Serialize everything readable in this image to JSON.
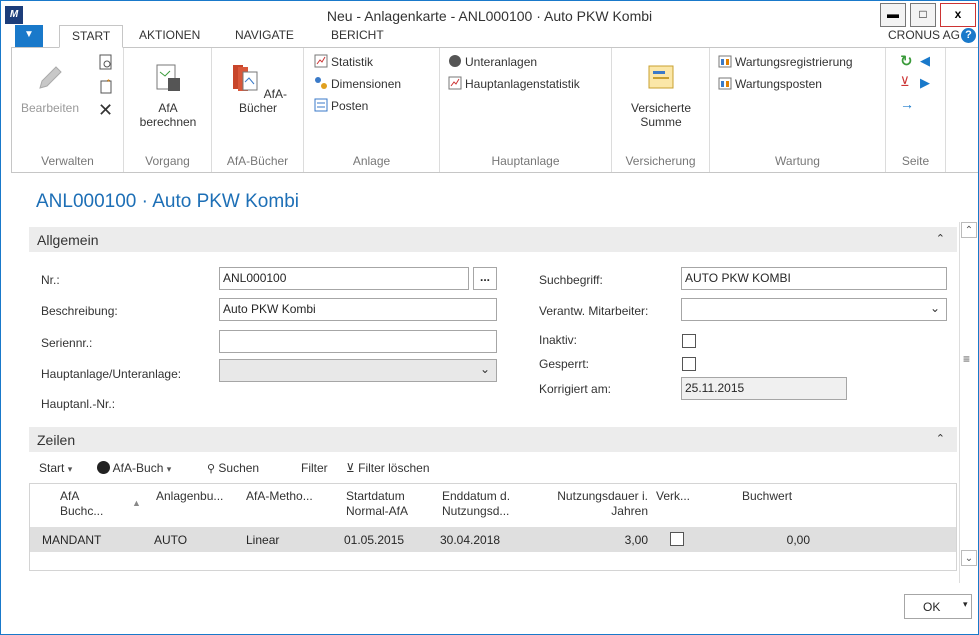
{
  "window": {
    "title": "Neu - Anlagenkarte - ANL000100 · Auto PKW Kombi",
    "app_logo": "M",
    "min_label": "▬",
    "max_label": "□",
    "close_label": "x"
  },
  "ribbon_tabs": [
    "START",
    "AKTIONEN",
    "NAVIGATE",
    "BERICHT"
  ],
  "company": "CRONUS AG",
  "ribbon": {
    "groups": [
      {
        "label": "Verwalten"
      },
      {
        "label": "Vorgang"
      },
      {
        "label": "AfA-Bücher"
      },
      {
        "label": "Anlage"
      },
      {
        "label": "Hauptanlage"
      },
      {
        "label": "Versicherung"
      },
      {
        "label": "Wartung"
      },
      {
        "label": "Seite"
      }
    ],
    "bearbeiten": "Bearbeiten",
    "afa_berechnen_1": "AfA",
    "afa_berechnen_2": "berechnen",
    "afa_buecher": "AfA-Bücher",
    "statistik": "Statistik",
    "dimensionen": "Dimensionen",
    "posten": "Posten",
    "unteranlagen": "Unteranlagen",
    "hauptanlagenstatistik": "Hauptanlagenstatistik",
    "versicherte_1": "Versicherte",
    "versicherte_2": "Summe",
    "wartungsregistrierung": "Wartungsregistrierung",
    "wartungsposten": "Wartungsposten"
  },
  "page_title": "ANL000100 · Auto PKW Kombi",
  "allgemein": {
    "title": "Allgemein",
    "nr_label": "Nr.:",
    "nr_value": "ANL000100",
    "ellipsis": "...",
    "beschreibung_label": "Beschreibung:",
    "beschreibung_value": "Auto PKW Kombi",
    "seriennr_label": "Seriennr.:",
    "seriennr_value": "",
    "hauptanlage_label": "Hauptanlage/Unteranlage:",
    "hauptanlage_value": "",
    "hauptanl_nr_label": "Hauptanl.-Nr.:",
    "suchbegriff_label": "Suchbegriff:",
    "suchbegriff_value": "AUTO PKW KOMBI",
    "verantw_label": "Verantw. Mitarbeiter:",
    "verantw_value": "",
    "inaktiv_label": "Inaktiv:",
    "gesperrt_label": "Gesperrt:",
    "korrigiert_label": "Korrigiert am:",
    "korrigiert_value": "25.11.2015"
  },
  "zeilen": {
    "title": "Zeilen",
    "toolbar": {
      "start": "Start",
      "afa_buch": "AfA-Buch",
      "suchen": "Suchen",
      "filter": "Filter",
      "filter_loeschen": "Filter löschen"
    },
    "headers": [
      [
        "AfA",
        "Buchc..."
      ],
      [
        "Anlagenbu..."
      ],
      [
        "AfA-Metho..."
      ],
      [
        "Startdatum",
        "Normal-AfA"
      ],
      [
        "Enddatum d.",
        "Nutzungsd..."
      ],
      [
        "Nutzungsdauer i.",
        "Jahren"
      ],
      [
        "Verk..."
      ],
      [
        "Buchwert"
      ]
    ],
    "rows": [
      {
        "afa_buch": "MANDANT",
        "anlagenbuch": "AUTO",
        "methode": "Linear",
        "startdatum": "01.05.2015",
        "enddatum": "30.04.2018",
        "nutzungsdauer": "3,00",
        "verkauft": false,
        "buchwert": "0,00"
      }
    ]
  },
  "ok_label": "OK"
}
